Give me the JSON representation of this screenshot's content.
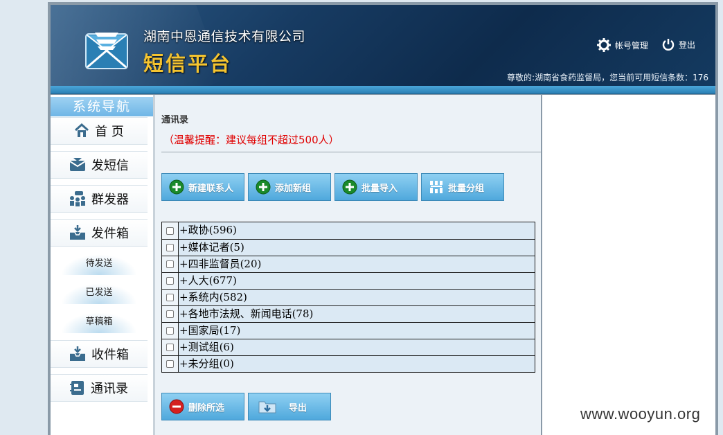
{
  "header": {
    "company": "湖南中恩通信技术有限公司",
    "platform": "短信平台",
    "account_link": "帐号管理",
    "logout_link": "登出",
    "greeting": "尊敬的:湖南省食药监督局，您当前可用短信条数：176"
  },
  "sidebar": {
    "title": "系统导航",
    "items": [
      {
        "label": "首 页",
        "icon": "home-icon"
      },
      {
        "label": "发短信",
        "icon": "envelope-icon"
      },
      {
        "label": "群发器",
        "icon": "group-send-icon"
      },
      {
        "label": "发件箱",
        "icon": "outbox-icon"
      },
      {
        "label": "收件箱",
        "icon": "inbox-icon"
      },
      {
        "label": "通讯录",
        "icon": "contacts-icon"
      }
    ],
    "outbox_sub": [
      "待发送",
      "已发送",
      "草稿箱"
    ]
  },
  "main": {
    "title": "通讯录",
    "warning": "（温馨提醒：建议每组不超过500人）",
    "toolbar": {
      "new_contact": "新建联系人",
      "add_group": "添加新组",
      "batch_import": "批量导入",
      "batch_group": "批量分组"
    },
    "groups": [
      "+政协(596)",
      "+媒体记者(5)",
      "+四非监督员(20)",
      "+人大(677)",
      "+系统内(582)",
      "+各地市法规、新闻电话(78)",
      "+国家局(17)",
      "+测试组(6)",
      "+未分组(0)"
    ],
    "bottom": {
      "delete_selected": "删除所选",
      "export": "导出"
    }
  },
  "watermark": "www.wooyun.org",
  "colors": {
    "header_bg": "#173b62",
    "platform_text": "#f4c430",
    "button_bg": "#4fa8dc",
    "warning_text": "#e00000"
  }
}
